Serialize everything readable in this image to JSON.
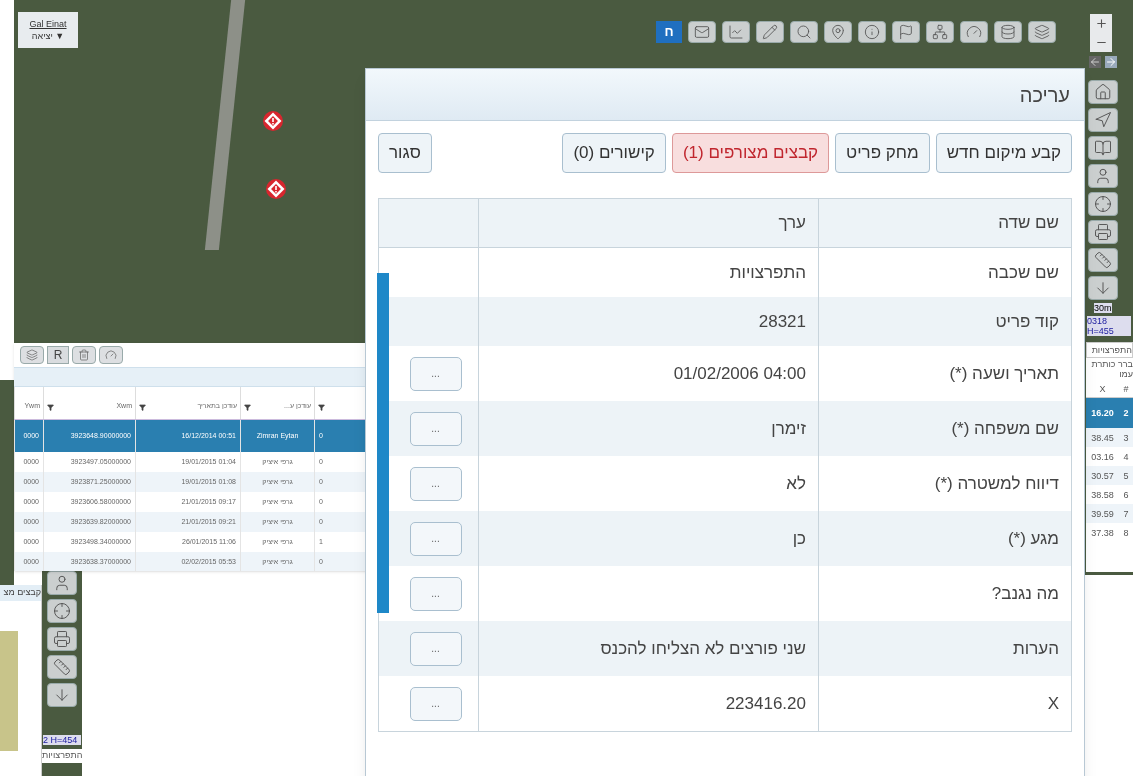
{
  "user_box": {
    "name": "Gal Einat",
    "logout": "יציאה ▼"
  },
  "top_toolbar": {
    "logo": "ח"
  },
  "map_markers": [
    {
      "kind": "warning"
    },
    {
      "kind": "warning"
    }
  ],
  "scale": {
    "label": "30m",
    "coords": "0318 H=455"
  },
  "results_toolbar": {
    "r_label": "R"
  },
  "results_table": {
    "columns": [
      "",
      "עודכן ע...",
      "עודכן בתאריך",
      "Xwm",
      "Ywm"
    ],
    "rows": [
      {
        "selected": true,
        "cells": [
          "0",
          "Zimran Eytan",
          "00:51 16/12/2014",
          "3923648.90000000",
          "0000"
        ]
      },
      {
        "selected": false,
        "cells": [
          "0",
          "גרפי איציק",
          "01:04 19/01/2015",
          "3923497.05000000",
          "0000"
        ]
      },
      {
        "selected": false,
        "cells": [
          "0",
          "גרפי איציק",
          "01:08 19/01/2015",
          "3923871.25000000",
          "0000"
        ]
      },
      {
        "selected": false,
        "cells": [
          "0",
          "גרפי איציק",
          "09:17 21/01/2015",
          "3923606.58000000",
          "0000"
        ]
      },
      {
        "selected": false,
        "cells": [
          "0",
          "גרפי איציק",
          "09:21 21/01/2015",
          "3923639.82000000",
          "0000"
        ]
      },
      {
        "selected": false,
        "cells": [
          "1",
          "גרפי איציק",
          "11:06 26/01/2015",
          "3923498.34000000",
          "0000"
        ]
      },
      {
        "selected": false,
        "cells": [
          "0",
          "גרפי איציק",
          "05:53 02/02/2015",
          "3923638.37000000",
          "0000"
        ]
      }
    ]
  },
  "side_table": {
    "tab": "התפרצויות",
    "filter": "ברר כותרת עמו",
    "columns": [
      "#",
      "X"
    ],
    "rows": [
      {
        "selected": true,
        "cells": [
          "2",
          "16.20"
        ]
      },
      {
        "selected": false,
        "cells": [
          "3",
          "38.45"
        ]
      },
      {
        "selected": false,
        "cells": [
          "4",
          "03.16"
        ]
      },
      {
        "selected": false,
        "cells": [
          "5",
          "30.57"
        ]
      },
      {
        "selected": false,
        "cells": [
          "6",
          "38.58"
        ]
      },
      {
        "selected": false,
        "cells": [
          "7",
          "39.59"
        ]
      },
      {
        "selected": false,
        "cells": [
          "8",
          "37.38"
        ]
      }
    ]
  },
  "back_window": {
    "title": "קבצים מצ",
    "coords": "2 H=454",
    "tab": "התפרצויות"
  },
  "dialog": {
    "title": "עריכה",
    "buttons": [
      {
        "label": "קבע מיקום חדש",
        "selected": false
      },
      {
        "label": "מחק פריט",
        "selected": false
      },
      {
        "label": "קבצים מצורפים (1)",
        "selected": true
      },
      {
        "label": "קישורים (0)",
        "selected": false
      }
    ],
    "close": "סגור",
    "columns": [
      "שם שדה",
      "ערך"
    ],
    "rows": [
      {
        "kind": "readonly",
        "field": "שם שכבה",
        "value": "התפרצויות"
      },
      {
        "kind": "readonly",
        "field": "קוד פריט",
        "value": "28321"
      },
      {
        "kind": "editable",
        "field": "תאריך ושעה (*)",
        "value": "04:00 01/02/2006",
        "button": "..."
      },
      {
        "kind": "editable",
        "field": "שם משפחה (*)",
        "value": "זימרן",
        "button": "..."
      },
      {
        "kind": "editable",
        "field": "דיווח למשטרה (*)",
        "value": "לא",
        "button": "..."
      },
      {
        "kind": "editable",
        "field": "מגע (*)",
        "value": "כן",
        "button": "..."
      },
      {
        "kind": "editable",
        "field": "מה נגנב?",
        "button": "..."
      },
      {
        "kind": "editable",
        "field": "הערות",
        "value": "שני פורצים לא הצליחו להכנס",
        "button": "..."
      },
      {
        "kind": "editable",
        "field": "X",
        "value": "223416.20",
        "button": "..."
      }
    ]
  }
}
